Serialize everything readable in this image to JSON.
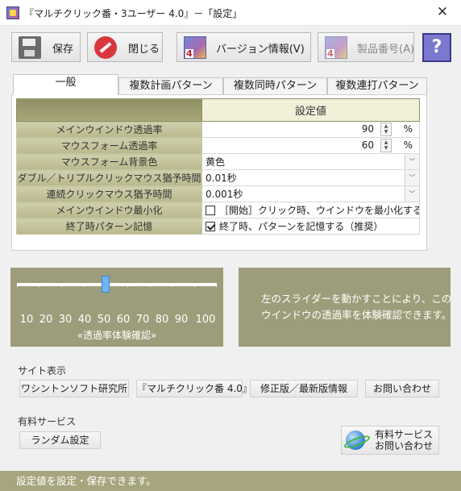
{
  "window": {
    "title": "『マルチクリック番・3ユーザー 4.0』－「設定」",
    "close_glyph": "✕"
  },
  "toolbar": {
    "save_label": "保存",
    "close_label": "閉じる",
    "version_label": "バージョン情報(V)",
    "serial_label": "製品番号(A)",
    "help_glyph": "?"
  },
  "tabs": [
    "一般",
    "複数計画パターン",
    "複数同時パターン",
    "複数連打パターン"
  ],
  "settings": {
    "value_header": "設定値",
    "rows": [
      {
        "label": "メインウインドウ透過率",
        "value": "90",
        "unit": "%"
      },
      {
        "label": "マウスフォーム透過率",
        "value": "60",
        "unit": "%"
      },
      {
        "label": "マウスフォーム背景色",
        "value": "黄色"
      },
      {
        "label": "ダブル／トリプルクリックマウス猶予時間",
        "value": "0.01秒"
      },
      {
        "label": "連続クリックマウス猶予時間",
        "value": "0.001秒"
      },
      {
        "label": "メインウインドウ最小化",
        "value": "［開始］クリック時、ウインドウを最小化する",
        "checked": false
      },
      {
        "label": "終了時パターン記憶",
        "value": "終了時、パターンを記憶する（推奨）",
        "checked": true
      }
    ]
  },
  "slider": {
    "value": 50,
    "min": 10,
    "max": 100,
    "ticks": [
      "10",
      "20",
      "30",
      "40",
      "50",
      "60",
      "70",
      "80",
      "90",
      "100"
    ],
    "caption": "«透過率体験確認»",
    "color": "#9e9d7b"
  },
  "info_text": "左のスライダーを動かすことにより、この\nウインドウの透過率を体験確認できます。",
  "site": {
    "label": "サイト表示",
    "buttons": [
      "ワシントンソフト研究所",
      "『マルチクリック番 4.0』",
      "修正版／最新版情報",
      "お問い合わせ"
    ]
  },
  "paid": {
    "label": "有料サービス",
    "random_button": "ランダム設定",
    "contact_line1": "有料サービス",
    "contact_line2": "お問い合わせ"
  },
  "status_text": "設定値を設定・保存できます。",
  "colors": {
    "accent": "#a6a57e",
    "header_cell": "#f1f0d8"
  }
}
